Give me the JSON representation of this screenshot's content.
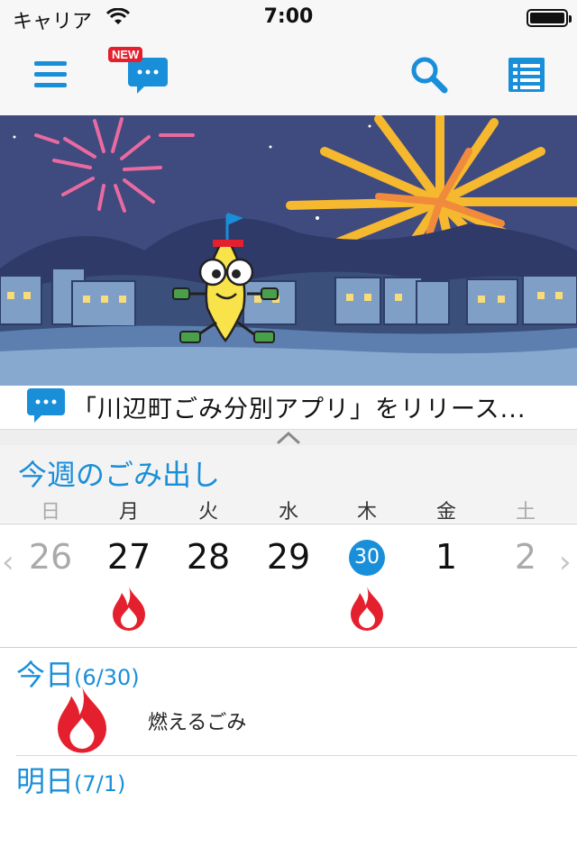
{
  "status_bar": {
    "carrier": "キャリア",
    "time": "7:00"
  },
  "toolbar": {
    "new_badge": "NEW",
    "menu_icon": "hamburger-menu-icon",
    "messages_icon": "chat-bubble-icon",
    "search_icon": "search-icon",
    "list_icon": "list-icon"
  },
  "news": {
    "text": "「川辺町ごみ分別アプリ」をリリース..."
  },
  "week": {
    "title": "今週のごみ出し",
    "days": [
      "日",
      "月",
      "火",
      "水",
      "木",
      "金",
      "土"
    ],
    "dates": [
      "26",
      "27",
      "28",
      "29",
      "30",
      "1",
      "2"
    ],
    "today_index": 4,
    "burnable_days": [
      "27",
      "30"
    ],
    "prev_label": "‹",
    "next_label": "›"
  },
  "today": {
    "label": "今日",
    "date": "(6/30)",
    "item": "燃えるごみ",
    "icon": "flame-icon"
  },
  "tomorrow": {
    "label": "明日",
    "date": "(7/1)"
  },
  "colors": {
    "accent": "#1a8fd9",
    "flame": "#e4202e",
    "badge": "#e4202e"
  }
}
